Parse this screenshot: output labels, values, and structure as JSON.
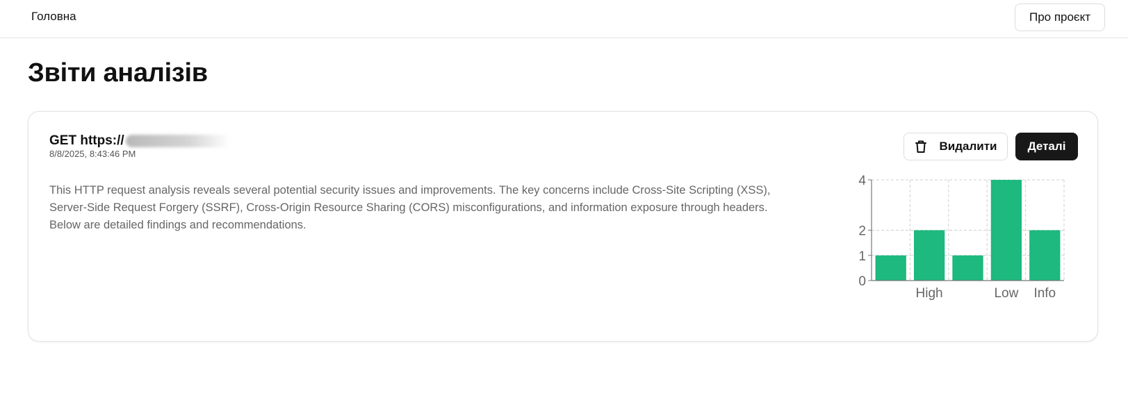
{
  "nav": {
    "home_label": "Головна",
    "about_label": "Про проєкт"
  },
  "page": {
    "title": "Звіти аналізів"
  },
  "report": {
    "method": "GET",
    "url_visible": "https://",
    "date": "8/8/2025, 8:43:46 PM",
    "summary": "This HTTP request analysis reveals several potential security issues and improvements. The key concerns include Cross-Site Scripting (XSS), Server-Side Request Forgery (SSRF), Cross-Origin Resource Sharing (CORS) misconfigurations, and information exposure through headers. Below are detailed findings and recommendations.",
    "delete_label": "Видалити",
    "details_label": "Деталі"
  },
  "chart_data": {
    "type": "bar",
    "categories": [
      "",
      "High",
      "",
      "Low",
      "Info"
    ],
    "values": [
      1,
      2,
      1,
      4,
      2
    ],
    "ylim": [
      0,
      4
    ],
    "yticks": [
      0,
      1,
      2,
      4
    ],
    "grid": true,
    "bar_color": "#1db97f"
  },
  "colors": {
    "accent_dark": "#181818",
    "bar": "#1db97f"
  }
}
